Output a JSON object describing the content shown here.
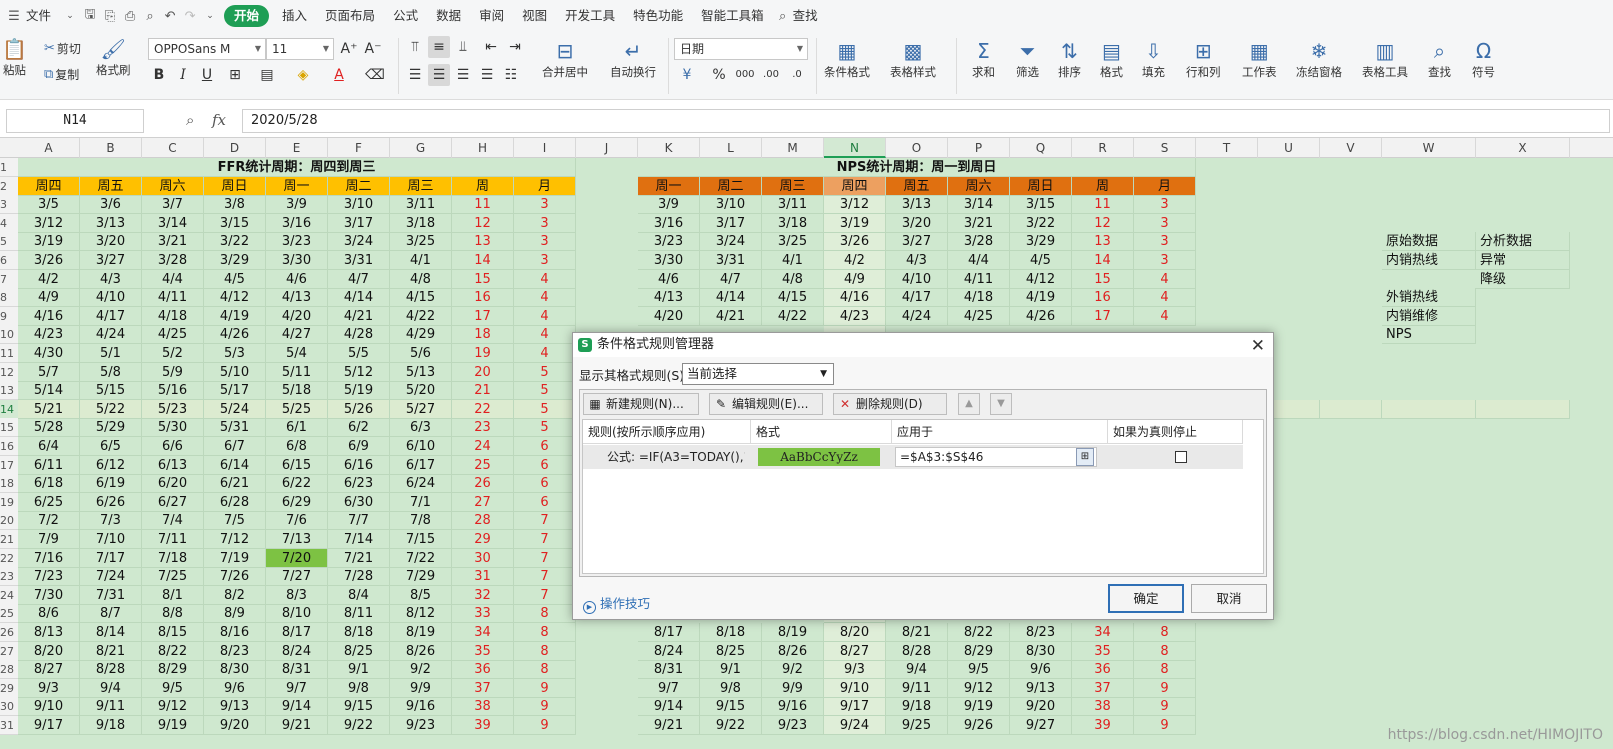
{
  "menubar": {
    "file": "文件",
    "tabs": [
      "开始",
      "插入",
      "页面布局",
      "公式",
      "数据",
      "审阅",
      "视图",
      "开发工具",
      "特色功能",
      "智能工具箱"
    ],
    "active_tab": "开始",
    "search": "查找"
  },
  "ribbon": {
    "paste": "粘贴",
    "cut": "剪切",
    "copy": "复制",
    "format_painter": "格式刷",
    "font_name": "OPPOSans M",
    "font_size": "11",
    "merge": "合并居中",
    "wrap": "自动换行",
    "number_format": "日期",
    "conditional_format": "条件格式",
    "table_style": "表格样式",
    "sum": "求和",
    "filter": "筛选",
    "sort": "排序",
    "format": "格式",
    "fill": "填充",
    "row_col": "行和列",
    "worksheet": "工作表",
    "freeze": "冻结窗格",
    "table_tools": "表格工具",
    "find": "查找",
    "symbol": "符号"
  },
  "formula_bar": {
    "name_box": "N14",
    "fx": "fx",
    "value": "2020/5/28"
  },
  "sheet": {
    "columns": [
      "A",
      "B",
      "C",
      "D",
      "E",
      "F",
      "G",
      "H",
      "I",
      "J",
      "K",
      "L",
      "M",
      "N",
      "O",
      "P",
      "Q",
      "R",
      "S",
      "T",
      "U",
      "V",
      "W",
      "X"
    ],
    "selected_column": "N",
    "selected_row": 14,
    "row_numbers": [
      "1",
      "2",
      "3",
      "4",
      "5",
      "6",
      "7",
      "8",
      "9",
      "10",
      "11",
      "12",
      "13",
      "14",
      "15",
      "16",
      "17",
      "18",
      "19",
      "20",
      "21",
      "22",
      "23",
      "24",
      "25",
      "26",
      "27",
      "28",
      "29",
      "30",
      "31"
    ],
    "ffr_title": "FFR统计周期：周四到周三",
    "nps_title": "NPS统计周期：周一到周日",
    "ffr_headers": [
      "周四",
      "周五",
      "周六",
      "周日",
      "周一",
      "周二",
      "周三",
      "周",
      "月"
    ],
    "nps_headers": [
      "周一",
      "周二",
      "周三",
      "周四",
      "周五",
      "周六",
      "周日",
      "周",
      "月"
    ],
    "ffr_rows": [
      [
        "3/5",
        "3/6",
        "3/7",
        "3/8",
        "3/9",
        "3/10",
        "3/11",
        "11",
        "3"
      ],
      [
        "3/12",
        "3/13",
        "3/14",
        "3/15",
        "3/16",
        "3/17",
        "3/18",
        "12",
        "3"
      ],
      [
        "3/19",
        "3/20",
        "3/21",
        "3/22",
        "3/23",
        "3/24",
        "3/25",
        "13",
        "3"
      ],
      [
        "3/26",
        "3/27",
        "3/28",
        "3/29",
        "3/30",
        "3/31",
        "4/1",
        "14",
        "3"
      ],
      [
        "4/2",
        "4/3",
        "4/4",
        "4/5",
        "4/6",
        "4/7",
        "4/8",
        "15",
        "4"
      ],
      [
        "4/9",
        "4/10",
        "4/11",
        "4/12",
        "4/13",
        "4/14",
        "4/15",
        "16",
        "4"
      ],
      [
        "4/16",
        "4/17",
        "4/18",
        "4/19",
        "4/20",
        "4/21",
        "4/22",
        "17",
        "4"
      ],
      [
        "4/23",
        "4/24",
        "4/25",
        "4/26",
        "4/27",
        "4/28",
        "4/29",
        "18",
        "4"
      ],
      [
        "4/30",
        "5/1",
        "5/2",
        "5/3",
        "5/4",
        "5/5",
        "5/6",
        "19",
        "4"
      ],
      [
        "5/7",
        "5/8",
        "5/9",
        "5/10",
        "5/11",
        "5/12",
        "5/13",
        "20",
        "5"
      ],
      [
        "5/14",
        "5/15",
        "5/16",
        "5/17",
        "5/18",
        "5/19",
        "5/20",
        "21",
        "5"
      ],
      [
        "5/21",
        "5/22",
        "5/23",
        "5/24",
        "5/25",
        "5/26",
        "5/27",
        "22",
        "5"
      ],
      [
        "5/28",
        "5/29",
        "5/30",
        "5/31",
        "6/1",
        "6/2",
        "6/3",
        "23",
        "5"
      ],
      [
        "6/4",
        "6/5",
        "6/6",
        "6/7",
        "6/8",
        "6/9",
        "6/10",
        "24",
        "6"
      ],
      [
        "6/11",
        "6/12",
        "6/13",
        "6/14",
        "6/15",
        "6/16",
        "6/17",
        "25",
        "6"
      ],
      [
        "6/18",
        "6/19",
        "6/20",
        "6/21",
        "6/22",
        "6/23",
        "6/24",
        "26",
        "6"
      ],
      [
        "6/25",
        "6/26",
        "6/27",
        "6/28",
        "6/29",
        "6/30",
        "7/1",
        "27",
        "6"
      ],
      [
        "7/2",
        "7/3",
        "7/4",
        "7/5",
        "7/6",
        "7/7",
        "7/8",
        "28",
        "7"
      ],
      [
        "7/9",
        "7/10",
        "7/11",
        "7/12",
        "7/13",
        "7/14",
        "7/15",
        "29",
        "7"
      ],
      [
        "7/16",
        "7/17",
        "7/18",
        "7/19",
        "7/20",
        "7/21",
        "7/22",
        "30",
        "7"
      ],
      [
        "7/23",
        "7/24",
        "7/25",
        "7/26",
        "7/27",
        "7/28",
        "7/29",
        "31",
        "7"
      ],
      [
        "7/30",
        "7/31",
        "8/1",
        "8/2",
        "8/3",
        "8/4",
        "8/5",
        "32",
        "7"
      ],
      [
        "8/6",
        "8/7",
        "8/8",
        "8/9",
        "8/10",
        "8/11",
        "8/12",
        "33",
        "8"
      ],
      [
        "8/13",
        "8/14",
        "8/15",
        "8/16",
        "8/17",
        "8/18",
        "8/19",
        "34",
        "8"
      ],
      [
        "8/20",
        "8/21",
        "8/22",
        "8/23",
        "8/24",
        "8/25",
        "8/26",
        "35",
        "8"
      ],
      [
        "8/27",
        "8/28",
        "8/29",
        "8/30",
        "8/31",
        "9/1",
        "9/2",
        "36",
        "8"
      ],
      [
        "9/3",
        "9/4",
        "9/5",
        "9/6",
        "9/7",
        "9/8",
        "9/9",
        "37",
        "9"
      ],
      [
        "9/10",
        "9/11",
        "9/12",
        "9/13",
        "9/14",
        "9/15",
        "9/16",
        "38",
        "9"
      ],
      [
        "9/17",
        "9/18",
        "9/19",
        "9/20",
        "9/21",
        "9/22",
        "9/23",
        "39",
        "9"
      ]
    ],
    "nps_rows": [
      [
        "3/9",
        "3/10",
        "3/11",
        "3/12",
        "3/13",
        "3/14",
        "3/15",
        "11",
        "3"
      ],
      [
        "3/16",
        "3/17",
        "3/18",
        "3/19",
        "3/20",
        "3/21",
        "3/22",
        "12",
        "3"
      ],
      [
        "3/23",
        "3/24",
        "3/25",
        "3/26",
        "3/27",
        "3/28",
        "3/29",
        "13",
        "3"
      ],
      [
        "3/30",
        "3/31",
        "4/1",
        "4/2",
        "4/3",
        "4/4",
        "4/5",
        "14",
        "3"
      ],
      [
        "4/6",
        "4/7",
        "4/8",
        "4/9",
        "4/10",
        "4/11",
        "4/12",
        "15",
        "4"
      ],
      [
        "4/13",
        "4/14",
        "4/15",
        "4/16",
        "4/17",
        "4/18",
        "4/19",
        "16",
        "4"
      ],
      [
        "4/20",
        "4/21",
        "4/22",
        "4/23",
        "4/24",
        "4/25",
        "4/26",
        "17",
        "4"
      ],
      null,
      null,
      null,
      null,
      null,
      null,
      null,
      null,
      null,
      null,
      null,
      null,
      null,
      null,
      null,
      null,
      [
        "8/17",
        "8/18",
        "8/19",
        "8/20",
        "8/21",
        "8/22",
        "8/23",
        "34",
        "8"
      ],
      [
        "8/24",
        "8/25",
        "8/26",
        "8/27",
        "8/28",
        "8/29",
        "8/30",
        "35",
        "8"
      ],
      [
        "8/31",
        "9/1",
        "9/2",
        "9/3",
        "9/4",
        "9/5",
        "9/6",
        "36",
        "8"
      ],
      [
        "9/7",
        "9/8",
        "9/9",
        "9/10",
        "9/11",
        "9/12",
        "9/13",
        "37",
        "9"
      ],
      [
        "9/14",
        "9/15",
        "9/16",
        "9/17",
        "9/18",
        "9/19",
        "9/20",
        "38",
        "9"
      ],
      [
        "9/21",
        "9/22",
        "9/23",
        "9/24",
        "9/25",
        "9/26",
        "9/27",
        "39",
        "9"
      ]
    ],
    "highlight_cell": "E22",
    "side_notes": {
      "W5": "原始数据",
      "X5": "分析数据",
      "W6": "内销热线",
      "X6": "异常",
      "X7": "降级",
      "W8": "外销热线",
      "W9": "内销维修",
      "W10": "NPS"
    }
  },
  "dialog": {
    "title": "条件格式规则管理器",
    "show_rules_label": "显示其格式规则(S):",
    "show_rules_value": "当前选择",
    "new_rule": "新建规则(N)...",
    "edit_rule": "编辑规则(E)...",
    "delete_rule": "删除规则(D)",
    "col_rule": "规则(按所示顺序应用)",
    "col_format": "格式",
    "col_applies": "应用于",
    "col_stop": "如果为真则停止",
    "rule_text": "公式: =IF(A3=TODAY(),1)",
    "format_preview": "AaBbCcYyZz",
    "applies_to": "=$A$3:$S$46",
    "tips": "操作技巧",
    "ok": "确定",
    "cancel": "取消",
    "preview_color": "#7dc243"
  },
  "watermark": "https://blog.csdn.net/HIMOJITO"
}
